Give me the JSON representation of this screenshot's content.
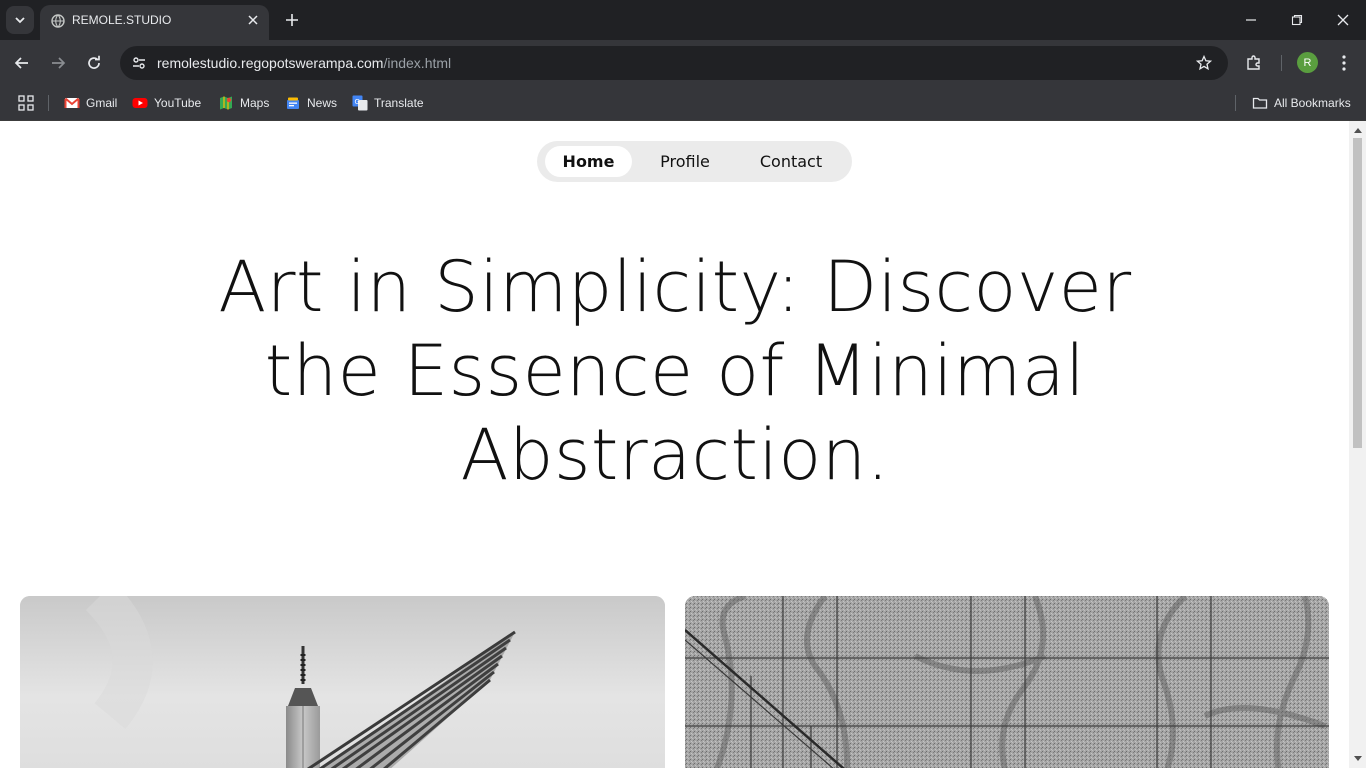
{
  "browser": {
    "tab_title": "REMOLE.STUDIO",
    "url_host": "remolestudio.regopotswerampa.com",
    "url_path": "/index.html",
    "profile_initial": "R",
    "bookmarks": [
      {
        "label": "Gmail",
        "icon": "gmail-icon"
      },
      {
        "label": "YouTube",
        "icon": "youtube-icon"
      },
      {
        "label": "Maps",
        "icon": "maps-icon"
      },
      {
        "label": "News",
        "icon": "news-icon"
      },
      {
        "label": "Translate",
        "icon": "translate-icon"
      }
    ],
    "all_bookmarks": "All Bookmarks"
  },
  "page": {
    "nav": {
      "home": "Home",
      "profile": "Profile",
      "contact": "Contact",
      "active": "Home"
    },
    "hero_title": "Art in Simplicity: Discover the Essence of Minimal Abstraction.",
    "gallery": [
      {
        "alt": "Black and white photo of a tower spire with angled architectural fins"
      },
      {
        "alt": "Black and white photo of a tiled stone wall with tree shadows"
      }
    ]
  },
  "colors": {
    "chrome_dark": "#202124",
    "chrome_mid": "#35363a",
    "nav_pill_bg": "#ebebeb",
    "text": "#111111"
  }
}
